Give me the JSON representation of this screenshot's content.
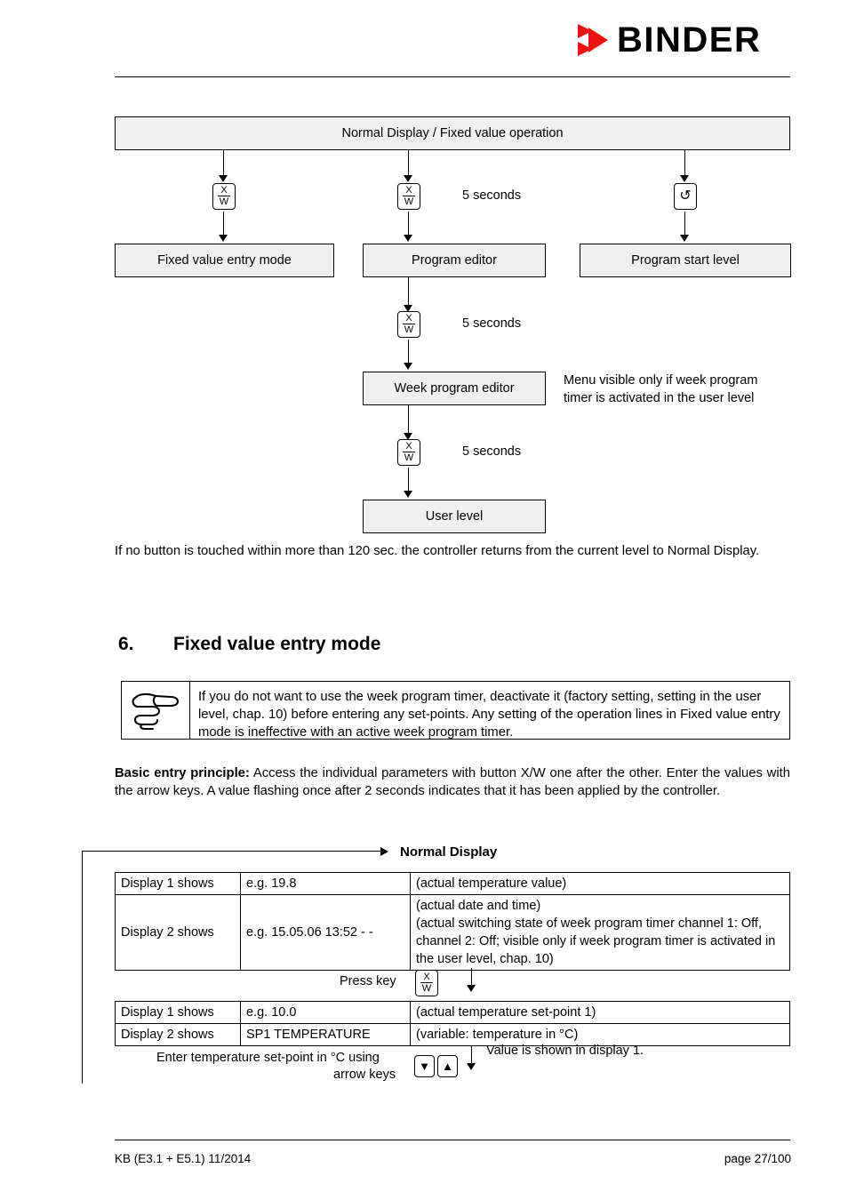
{
  "header": {
    "brand": "BINDER",
    "logo_icon": "binder-triangles-logo"
  },
  "flow": {
    "top_box": "Normal Display / Fixed value operation",
    "branches": [
      {
        "key_icon": "xw-key",
        "key_top": "X",
        "key_bottom": "W",
        "timing": "",
        "target": "Fixed value entry mode"
      },
      {
        "key_icon": "xw-key",
        "key_top": "X",
        "key_bottom": "W",
        "timing": "5 seconds",
        "target": "Program editor"
      },
      {
        "key_icon": "power-key",
        "key_glyph": "↺",
        "timing": "",
        "target": "Program start level"
      }
    ],
    "sub_steps": [
      {
        "key_icon": "xw-key",
        "key_top": "X",
        "key_bottom": "W",
        "timing": "5 seconds",
        "target": "Week program editor"
      },
      {
        "key_icon": "xw-key",
        "key_top": "X",
        "key_bottom": "W",
        "timing": "5 seconds",
        "target": "User level"
      }
    ],
    "side_note": "Menu visible only if week program timer is activated in the user level"
  },
  "timeout_paragraph": "If no button is touched within more than 120 sec. the controller returns from the current level to Normal Display.",
  "section": {
    "number": "6.",
    "title": "Fixed value entry mode"
  },
  "note": {
    "icon": "pointing-hand-icon",
    "text": "If you do not want to use the week program timer, deactivate it (factory setting, setting in the user level, chap. 10) before entering any set-points. Any setting of the operation lines in Fixed value entry mode is ineffective with an active week program timer."
  },
  "basic_entry": {
    "lead": "Basic entry principle:",
    "body": " Access the individual parameters with button X/W one after the other. Enter the values with the arrow keys. A value flashing once after 2 seconds indicates that it has been applied by the controller."
  },
  "normal_display": {
    "heading": "Normal Display",
    "rows": [
      {
        "label": "Display 1 shows",
        "value": "e.g. 19.8",
        "description": [
          "(actual temperature value)"
        ]
      },
      {
        "label": "Display 2 shows",
        "value": "e.g. 15.05.06  13:52 - -",
        "description": [
          "(actual date and time)",
          "(actual switching state of week program timer channel 1: Off, channel 2: Off; visible only if week program timer is activated in the user level, chap. 10)"
        ]
      }
    ]
  },
  "press_key": {
    "label": "Press key",
    "key_icon": "xw-key",
    "key_top": "X",
    "key_bottom": "W",
    "flow_arrow": "down-arrow-icon"
  },
  "setpoint_table": {
    "rows": [
      {
        "label": "Display 1 shows",
        "value": "e.g. 10.0",
        "description": "(actual temperature set-point 1)"
      },
      {
        "label": "Display 2 shows",
        "value": "SP1 TEMPERATURE",
        "description": "(variable: temperature in °C)"
      }
    ]
  },
  "entry_hint": {
    "line1": "Enter temperature set-point in °C using",
    "line2": "arrow keys",
    "down_key": "▼",
    "up_key": "▲",
    "result": "Value is shown in display 1."
  },
  "footer": {
    "left": "KB (E3.1 + E5.1) 11/2014",
    "right": "page 27/100"
  }
}
